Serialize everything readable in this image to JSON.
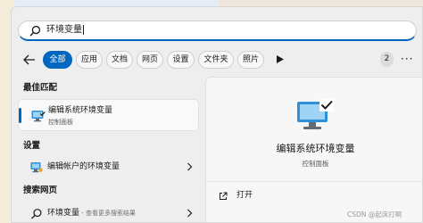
{
  "search": {
    "query": "环境变量"
  },
  "filters": {
    "chips": [
      "全部",
      "应用",
      "文档",
      "网页",
      "设置",
      "文件夹",
      "照片"
    ],
    "count_badge": "2",
    "more_label": "···"
  },
  "best_match": {
    "section_title": "最佳匹配",
    "title": "编辑系统环境变量",
    "subtitle": "控制面板",
    "icon": "computer-monitor-checkmark-icon"
  },
  "settings": {
    "section_title": "设置",
    "items": [
      {
        "label": "编辑帐户的环境变量",
        "icon": "account-environment-icon"
      }
    ]
  },
  "web": {
    "section_title": "搜索网页",
    "items": [
      {
        "label": "环境变量",
        "hint": " - 查看更多搜索结果",
        "icon": "search-icon"
      }
    ]
  },
  "detail": {
    "title": "编辑系统环境变量",
    "subtitle": "控制面板",
    "actions": [
      {
        "label": "打开",
        "icon": "open-external-icon"
      }
    ]
  },
  "watermark": "CSDN @起床打啊",
  "colors": {
    "accent": "#0067c0",
    "panel": "#eeeeee"
  }
}
